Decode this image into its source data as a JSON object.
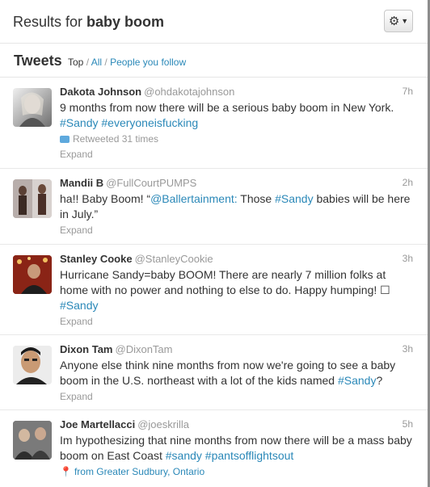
{
  "header": {
    "title_prefix": "Results for ",
    "query": "baby boom"
  },
  "tabs": {
    "label": "Tweets",
    "top": "Top",
    "sep1": " / ",
    "all": "All",
    "sep2": " / ",
    "follow": "People you follow"
  },
  "icons": {
    "settings": "gear-icon",
    "retweet": "retweet-icon",
    "location": "map-pin-icon"
  },
  "tweets": [
    {
      "name": "Dakota Johnson",
      "handle": "@ohdakotajohnson",
      "time": "7h",
      "text1": "9 months from now there will be a serious baby boom in New York. ",
      "tag1": "#Sandy",
      "text2": " ",
      "tag2": "#everyoneisfucking",
      "meta": "Retweeted 31 times",
      "expand": "Expand"
    },
    {
      "name": "Mandii B",
      "handle": "@FullCourtPUMPS",
      "time": "2h",
      "text1": "ha!! Baby Boom! “",
      "mention": "@Ballertainment:",
      "text2": " Those ",
      "tag1": "#Sandy",
      "text3": " babies will be here in July.”",
      "expand": "Expand"
    },
    {
      "name": "Stanley Cooke",
      "handle": "@StanleyCookie",
      "time": "3h",
      "text1": "Hurricane Sandy=baby BOOM! There are nearly 7 million folks at home with no power and nothing to else to do. Happy humping! ☐ ",
      "tag1": "#Sandy",
      "expand": "Expand"
    },
    {
      "name": "Dixon Tam",
      "handle": "@DixonTam",
      "time": "3h",
      "text1": "Anyone else think nine months from now we're going to see a baby boom in the U.S. northeast with a lot of the kids named ",
      "tag1": "#Sandy",
      "text2": "?",
      "expand": "Expand"
    },
    {
      "name": "Joe Martellacci",
      "handle": "@joeskrilla",
      "time": "5h",
      "text1": "Im hypothesizing that nine months from now there will be a mass baby boom on East Coast ",
      "tag1": "#sandy",
      "text2": " ",
      "tag2": "#pantsofflightsout",
      "place": "from Greater Sudbury, Ontario"
    }
  ]
}
